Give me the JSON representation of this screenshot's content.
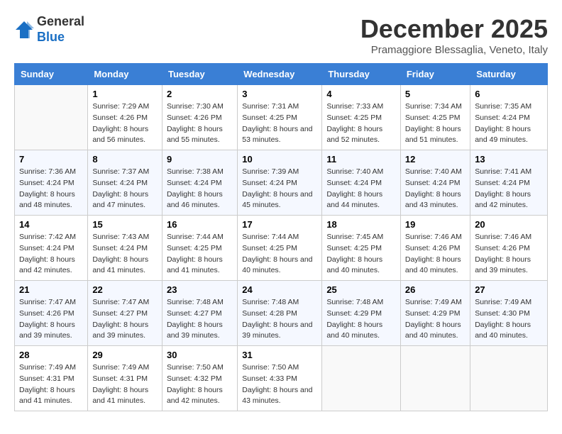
{
  "logo": {
    "general": "General",
    "blue": "Blue"
  },
  "title": "December 2025",
  "subtitle": "Pramaggiore Blessaglia, Veneto, Italy",
  "days_of_week": [
    "Sunday",
    "Monday",
    "Tuesday",
    "Wednesday",
    "Thursday",
    "Friday",
    "Saturday"
  ],
  "weeks": [
    [
      {
        "num": "",
        "sunrise": "",
        "sunset": "",
        "daylight": ""
      },
      {
        "num": "1",
        "sunrise": "Sunrise: 7:29 AM",
        "sunset": "Sunset: 4:26 PM",
        "daylight": "Daylight: 8 hours and 56 minutes."
      },
      {
        "num": "2",
        "sunrise": "Sunrise: 7:30 AM",
        "sunset": "Sunset: 4:26 PM",
        "daylight": "Daylight: 8 hours and 55 minutes."
      },
      {
        "num": "3",
        "sunrise": "Sunrise: 7:31 AM",
        "sunset": "Sunset: 4:25 PM",
        "daylight": "Daylight: 8 hours and 53 minutes."
      },
      {
        "num": "4",
        "sunrise": "Sunrise: 7:33 AM",
        "sunset": "Sunset: 4:25 PM",
        "daylight": "Daylight: 8 hours and 52 minutes."
      },
      {
        "num": "5",
        "sunrise": "Sunrise: 7:34 AM",
        "sunset": "Sunset: 4:25 PM",
        "daylight": "Daylight: 8 hours and 51 minutes."
      },
      {
        "num": "6",
        "sunrise": "Sunrise: 7:35 AM",
        "sunset": "Sunset: 4:24 PM",
        "daylight": "Daylight: 8 hours and 49 minutes."
      }
    ],
    [
      {
        "num": "7",
        "sunrise": "Sunrise: 7:36 AM",
        "sunset": "Sunset: 4:24 PM",
        "daylight": "Daylight: 8 hours and 48 minutes."
      },
      {
        "num": "8",
        "sunrise": "Sunrise: 7:37 AM",
        "sunset": "Sunset: 4:24 PM",
        "daylight": "Daylight: 8 hours and 47 minutes."
      },
      {
        "num": "9",
        "sunrise": "Sunrise: 7:38 AM",
        "sunset": "Sunset: 4:24 PM",
        "daylight": "Daylight: 8 hours and 46 minutes."
      },
      {
        "num": "10",
        "sunrise": "Sunrise: 7:39 AM",
        "sunset": "Sunset: 4:24 PM",
        "daylight": "Daylight: 8 hours and 45 minutes."
      },
      {
        "num": "11",
        "sunrise": "Sunrise: 7:40 AM",
        "sunset": "Sunset: 4:24 PM",
        "daylight": "Daylight: 8 hours and 44 minutes."
      },
      {
        "num": "12",
        "sunrise": "Sunrise: 7:40 AM",
        "sunset": "Sunset: 4:24 PM",
        "daylight": "Daylight: 8 hours and 43 minutes."
      },
      {
        "num": "13",
        "sunrise": "Sunrise: 7:41 AM",
        "sunset": "Sunset: 4:24 PM",
        "daylight": "Daylight: 8 hours and 42 minutes."
      }
    ],
    [
      {
        "num": "14",
        "sunrise": "Sunrise: 7:42 AM",
        "sunset": "Sunset: 4:24 PM",
        "daylight": "Daylight: 8 hours and 42 minutes."
      },
      {
        "num": "15",
        "sunrise": "Sunrise: 7:43 AM",
        "sunset": "Sunset: 4:24 PM",
        "daylight": "Daylight: 8 hours and 41 minutes."
      },
      {
        "num": "16",
        "sunrise": "Sunrise: 7:44 AM",
        "sunset": "Sunset: 4:25 PM",
        "daylight": "Daylight: 8 hours and 41 minutes."
      },
      {
        "num": "17",
        "sunrise": "Sunrise: 7:44 AM",
        "sunset": "Sunset: 4:25 PM",
        "daylight": "Daylight: 8 hours and 40 minutes."
      },
      {
        "num": "18",
        "sunrise": "Sunrise: 7:45 AM",
        "sunset": "Sunset: 4:25 PM",
        "daylight": "Daylight: 8 hours and 40 minutes."
      },
      {
        "num": "19",
        "sunrise": "Sunrise: 7:46 AM",
        "sunset": "Sunset: 4:26 PM",
        "daylight": "Daylight: 8 hours and 40 minutes."
      },
      {
        "num": "20",
        "sunrise": "Sunrise: 7:46 AM",
        "sunset": "Sunset: 4:26 PM",
        "daylight": "Daylight: 8 hours and 39 minutes."
      }
    ],
    [
      {
        "num": "21",
        "sunrise": "Sunrise: 7:47 AM",
        "sunset": "Sunset: 4:26 PM",
        "daylight": "Daylight: 8 hours and 39 minutes."
      },
      {
        "num": "22",
        "sunrise": "Sunrise: 7:47 AM",
        "sunset": "Sunset: 4:27 PM",
        "daylight": "Daylight: 8 hours and 39 minutes."
      },
      {
        "num": "23",
        "sunrise": "Sunrise: 7:48 AM",
        "sunset": "Sunset: 4:27 PM",
        "daylight": "Daylight: 8 hours and 39 minutes."
      },
      {
        "num": "24",
        "sunrise": "Sunrise: 7:48 AM",
        "sunset": "Sunset: 4:28 PM",
        "daylight": "Daylight: 8 hours and 39 minutes."
      },
      {
        "num": "25",
        "sunrise": "Sunrise: 7:48 AM",
        "sunset": "Sunset: 4:29 PM",
        "daylight": "Daylight: 8 hours and 40 minutes."
      },
      {
        "num": "26",
        "sunrise": "Sunrise: 7:49 AM",
        "sunset": "Sunset: 4:29 PM",
        "daylight": "Daylight: 8 hours and 40 minutes."
      },
      {
        "num": "27",
        "sunrise": "Sunrise: 7:49 AM",
        "sunset": "Sunset: 4:30 PM",
        "daylight": "Daylight: 8 hours and 40 minutes."
      }
    ],
    [
      {
        "num": "28",
        "sunrise": "Sunrise: 7:49 AM",
        "sunset": "Sunset: 4:31 PM",
        "daylight": "Daylight: 8 hours and 41 minutes."
      },
      {
        "num": "29",
        "sunrise": "Sunrise: 7:49 AM",
        "sunset": "Sunset: 4:31 PM",
        "daylight": "Daylight: 8 hours and 41 minutes."
      },
      {
        "num": "30",
        "sunrise": "Sunrise: 7:50 AM",
        "sunset": "Sunset: 4:32 PM",
        "daylight": "Daylight: 8 hours and 42 minutes."
      },
      {
        "num": "31",
        "sunrise": "Sunrise: 7:50 AM",
        "sunset": "Sunset: 4:33 PM",
        "daylight": "Daylight: 8 hours and 43 minutes."
      },
      {
        "num": "",
        "sunrise": "",
        "sunset": "",
        "daylight": ""
      },
      {
        "num": "",
        "sunrise": "",
        "sunset": "",
        "daylight": ""
      },
      {
        "num": "",
        "sunrise": "",
        "sunset": "",
        "daylight": ""
      }
    ]
  ]
}
